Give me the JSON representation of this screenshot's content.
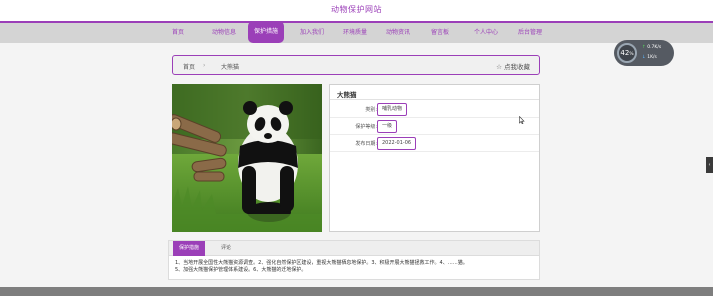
{
  "site": {
    "title": "动物保护网站"
  },
  "nav": {
    "items": [
      {
        "label": "首页"
      },
      {
        "label": "动物信息"
      },
      {
        "label": "保护措施"
      },
      {
        "label": "加入我们"
      },
      {
        "label": "环境质量"
      },
      {
        "label": "动物资讯"
      },
      {
        "label": "留言板"
      },
      {
        "label": "个人中心"
      },
      {
        "label": "后台管理"
      }
    ],
    "active_index": 2
  },
  "breadcrumb": {
    "home": "首页",
    "separator": "›",
    "current": "大熊猫",
    "favorite": "☆ 点我收藏"
  },
  "detail": {
    "title": "大熊猫",
    "fields": [
      {
        "label": "类别:",
        "value": "哺乳动物"
      },
      {
        "label": "保护等级:",
        "value": "一级"
      },
      {
        "label": "发布日期:",
        "value": "2022-01-06"
      }
    ]
  },
  "tabs": [
    {
      "label": "保护措施"
    },
    {
      "label": "评论"
    }
  ],
  "content": {
    "text": "1、当地开展全国性大熊猫资源调查。2、强化自然保护区建设，重视大熊猫栖息地保护。3、积极开展大熊猫拯救工作。4、……猫。5、加强大熊猫保护管理体系建设。6、大熊猫的迁地保护。"
  },
  "speed_widget": {
    "percent": "42",
    "percent_sign": "%",
    "up": "0.7K/s",
    "down": "1K/s",
    "up_arrow": "↑",
    "down_arrow": "↓"
  },
  "colors": {
    "accent": "#9b3fb8",
    "nav_bg": "#d4d4d4",
    "page_bg": "#f4f4f4"
  }
}
